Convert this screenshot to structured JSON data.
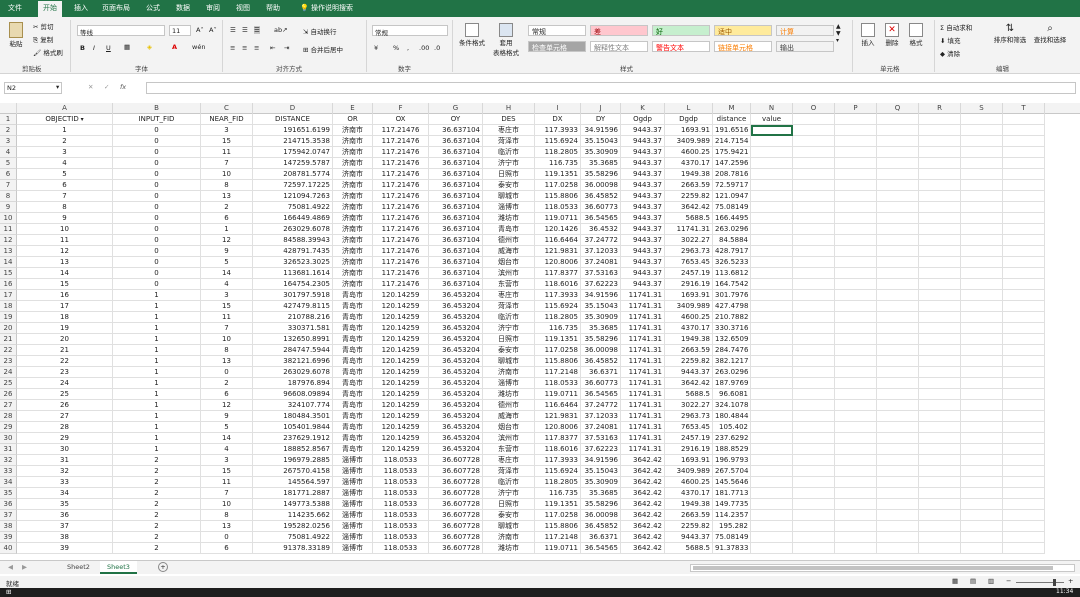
{
  "tabs": [
    "文件",
    "开始",
    "插入",
    "页面布局",
    "公式",
    "数据",
    "审阅",
    "视图",
    "帮助"
  ],
  "tell_me": "操作说明搜索",
  "ribbon": {
    "clipboard": {
      "paste": "粘贴",
      "cut": "剪切",
      "copy": "复制",
      "format_painter": "格式刷",
      "label": "剪贴板"
    },
    "font": {
      "name": "等线",
      "size": "11",
      "label": "字体"
    },
    "alignment": {
      "wrap": "自动换行",
      "merge": "合并后居中",
      "label": "对齐方式"
    },
    "number": {
      "format": "常规",
      "label": "数字"
    },
    "styles": {
      "cond_format": "条件格式",
      "table_format": "套用\n表格格式",
      "label": "样式",
      "cells": [
        {
          "text": "常规",
          "bg": "#ffffff",
          "fg": "#222222"
        },
        {
          "text": "差",
          "bg": "#ffc7ce",
          "fg": "#9c0006"
        },
        {
          "text": "好",
          "bg": "#c6efce",
          "fg": "#006100"
        },
        {
          "text": "适中",
          "bg": "#ffeb9c",
          "fg": "#9c5700"
        },
        {
          "text": "计算",
          "bg": "#f2f2f2",
          "fg": "#fa7d00"
        },
        {
          "text": "检查单元格",
          "bg": "#a5a5a5",
          "fg": "#ffffff"
        },
        {
          "text": "解释性文本",
          "bg": "#ffffff",
          "fg": "#7f7f7f"
        },
        {
          "text": "警告文本",
          "bg": "#ffffff",
          "fg": "#ff0000"
        },
        {
          "text": "链接单元格",
          "bg": "#ffffff",
          "fg": "#fa7d00"
        },
        {
          "text": "输出",
          "bg": "#f2f2f2",
          "fg": "#3f3f3f"
        }
      ]
    },
    "cells": {
      "insert": "插入",
      "delete": "删除",
      "format": "格式",
      "label": "单元格"
    },
    "editing": {
      "autosum": "自动求和",
      "fill": "填充",
      "clear": "清除",
      "sort": "排序和筛选",
      "find": "查找和选择",
      "label": "编辑"
    }
  },
  "formula_bar": {
    "name_box": "N2",
    "fx": "fx",
    "content": ""
  },
  "columns": [
    "A",
    "B",
    "C",
    "D",
    "E",
    "F",
    "G",
    "H",
    "I",
    "J",
    "K",
    "L",
    "M",
    "N",
    "O",
    "P",
    "Q",
    "R",
    "S",
    "T"
  ],
  "header_row": [
    "OBJECTID",
    "INPUT_FID",
    "NEAR_FID",
    "DISTANCE",
    "OR",
    "OX",
    "OY",
    "DES",
    "DX",
    "DY",
    "Ogdp",
    "Dgdp",
    "distance",
    "value"
  ],
  "data_rows": [
    [
      "1",
      "0",
      "3",
      "191651.6199",
      "济南市",
      "117.21476",
      "36.637104",
      "枣庄市",
      "117.3933",
      "34.91596",
      "9443.37",
      "1693.91",
      "191.6516"
    ],
    [
      "2",
      "0",
      "15",
      "214715.3538",
      "济南市",
      "117.21476",
      "36.637104",
      "菏泽市",
      "115.6924",
      "35.15043",
      "9443.37",
      "3409.989",
      "214.7154"
    ],
    [
      "3",
      "0",
      "11",
      "175942.0747",
      "济南市",
      "117.21476",
      "36.637104",
      "临沂市",
      "118.2805",
      "35.30909",
      "9443.37",
      "4600.25",
      "175.9421"
    ],
    [
      "4",
      "0",
      "7",
      "147259.5787",
      "济南市",
      "117.21476",
      "36.637104",
      "济宁市",
      "116.735",
      "35.3685",
      "9443.37",
      "4370.17",
      "147.2596"
    ],
    [
      "5",
      "0",
      "10",
      "208781.5774",
      "济南市",
      "117.21476",
      "36.637104",
      "日照市",
      "119.1351",
      "35.58296",
      "9443.37",
      "1949.38",
      "208.7816"
    ],
    [
      "6",
      "0",
      "8",
      "72597.17225",
      "济南市",
      "117.21476",
      "36.637104",
      "泰安市",
      "117.0258",
      "36.00098",
      "9443.37",
      "2663.59",
      "72.59717"
    ],
    [
      "7",
      "0",
      "13",
      "121094.7263",
      "济南市",
      "117.21476",
      "36.637104",
      "聊城市",
      "115.8806",
      "36.45852",
      "9443.37",
      "2259.82",
      "121.0947"
    ],
    [
      "8",
      "0",
      "2",
      "75081.4922",
      "济南市",
      "117.21476",
      "36.637104",
      "淄博市",
      "118.0533",
      "36.60773",
      "9443.37",
      "3642.42",
      "75.08149"
    ],
    [
      "9",
      "0",
      "6",
      "166449.4869",
      "济南市",
      "117.21476",
      "36.637104",
      "潍坊市",
      "119.0711",
      "36.54565",
      "9443.37",
      "5688.5",
      "166.4495"
    ],
    [
      "10",
      "0",
      "1",
      "263029.6078",
      "济南市",
      "117.21476",
      "36.637104",
      "青岛市",
      "120.1426",
      "36.4532",
      "9443.37",
      "11741.31",
      "263.0296"
    ],
    [
      "11",
      "0",
      "12",
      "84588.39943",
      "济南市",
      "117.21476",
      "36.637104",
      "德州市",
      "116.6464",
      "37.24772",
      "9443.37",
      "3022.27",
      "84.5884"
    ],
    [
      "12",
      "0",
      "9",
      "428791.7435",
      "济南市",
      "117.21476",
      "36.637104",
      "威海市",
      "121.9831",
      "37.12033",
      "9443.37",
      "2963.73",
      "428.7917"
    ],
    [
      "13",
      "0",
      "5",
      "326523.3025",
      "济南市",
      "117.21476",
      "36.637104",
      "烟台市",
      "120.8006",
      "37.24081",
      "9443.37",
      "7653.45",
      "326.5233"
    ],
    [
      "14",
      "0",
      "14",
      "113681.1614",
      "济南市",
      "117.21476",
      "36.637104",
      "滨州市",
      "117.8377",
      "37.53163",
      "9443.37",
      "2457.19",
      "113.6812"
    ],
    [
      "15",
      "0",
      "4",
      "164754.2305",
      "济南市",
      "117.21476",
      "36.637104",
      "东营市",
      "118.6016",
      "37.62223",
      "9443.37",
      "2916.19",
      "164.7542"
    ],
    [
      "16",
      "1",
      "3",
      "301797.5918",
      "青岛市",
      "120.14259",
      "36.453204",
      "枣庄市",
      "117.3933",
      "34.91596",
      "11741.31",
      "1693.91",
      "301.7976"
    ],
    [
      "17",
      "1",
      "15",
      "427479.8115",
      "青岛市",
      "120.14259",
      "36.453204",
      "菏泽市",
      "115.6924",
      "35.15043",
      "11741.31",
      "3409.989",
      "427.4798"
    ],
    [
      "18",
      "1",
      "11",
      "210788.216",
      "青岛市",
      "120.14259",
      "36.453204",
      "临沂市",
      "118.2805",
      "35.30909",
      "11741.31",
      "4600.25",
      "210.7882"
    ],
    [
      "19",
      "1",
      "7",
      "330371.581",
      "青岛市",
      "120.14259",
      "36.453204",
      "济宁市",
      "116.735",
      "35.3685",
      "11741.31",
      "4370.17",
      "330.3716"
    ],
    [
      "20",
      "1",
      "10",
      "132650.8991",
      "青岛市",
      "120.14259",
      "36.453204",
      "日照市",
      "119.1351",
      "35.58296",
      "11741.31",
      "1949.38",
      "132.6509"
    ],
    [
      "21",
      "1",
      "8",
      "284747.5944",
      "青岛市",
      "120.14259",
      "36.453204",
      "泰安市",
      "117.0258",
      "36.00098",
      "11741.31",
      "2663.59",
      "284.7476"
    ],
    [
      "22",
      "1",
      "13",
      "382121.6996",
      "青岛市",
      "120.14259",
      "36.453204",
      "聊城市",
      "115.8806",
      "36.45852",
      "11741.31",
      "2259.82",
      "382.1217"
    ],
    [
      "23",
      "1",
      "0",
      "263029.6078",
      "青岛市",
      "120.14259",
      "36.453204",
      "济南市",
      "117.2148",
      "36.6371",
      "11741.31",
      "9443.37",
      "263.0296"
    ],
    [
      "24",
      "1",
      "2",
      "187976.894",
      "青岛市",
      "120.14259",
      "36.453204",
      "淄博市",
      "118.0533",
      "36.60773",
      "11741.31",
      "3642.42",
      "187.9769"
    ],
    [
      "25",
      "1",
      "6",
      "96608.09894",
      "青岛市",
      "120.14259",
      "36.453204",
      "潍坊市",
      "119.0711",
      "36.54565",
      "11741.31",
      "5688.5",
      "96.6081"
    ],
    [
      "26",
      "1",
      "12",
      "324107.774",
      "青岛市",
      "120.14259",
      "36.453204",
      "德州市",
      "116.6464",
      "37.24772",
      "11741.31",
      "3022.27",
      "324.1078"
    ],
    [
      "27",
      "1",
      "9",
      "180484.3501",
      "青岛市",
      "120.14259",
      "36.453204",
      "威海市",
      "121.9831",
      "37.12033",
      "11741.31",
      "2963.73",
      "180.4844"
    ],
    [
      "28",
      "1",
      "5",
      "105401.9844",
      "青岛市",
      "120.14259",
      "36.453204",
      "烟台市",
      "120.8006",
      "37.24081",
      "11741.31",
      "7653.45",
      "105.402"
    ],
    [
      "29",
      "1",
      "14",
      "237629.1912",
      "青岛市",
      "120.14259",
      "36.453204",
      "滨州市",
      "117.8377",
      "37.53163",
      "11741.31",
      "2457.19",
      "237.6292"
    ],
    [
      "30",
      "1",
      "4",
      "188852.8567",
      "青岛市",
      "120.14259",
      "36.453204",
      "东营市",
      "118.6016",
      "37.62223",
      "11741.31",
      "2916.19",
      "188.8529"
    ],
    [
      "31",
      "2",
      "3",
      "196979.2885",
      "淄博市",
      "118.0533",
      "36.607728",
      "枣庄市",
      "117.3933",
      "34.91596",
      "3642.42",
      "1693.91",
      "196.9793"
    ],
    [
      "32",
      "2",
      "15",
      "267570.4158",
      "淄博市",
      "118.0533",
      "36.607728",
      "菏泽市",
      "115.6924",
      "35.15043",
      "3642.42",
      "3409.989",
      "267.5704"
    ],
    [
      "33",
      "2",
      "11",
      "145564.597",
      "淄博市",
      "118.0533",
      "36.607728",
      "临沂市",
      "118.2805",
      "35.30909",
      "3642.42",
      "4600.25",
      "145.5646"
    ],
    [
      "34",
      "2",
      "7",
      "181771.2887",
      "淄博市",
      "118.0533",
      "36.607728",
      "济宁市",
      "116.735",
      "35.3685",
      "3642.42",
      "4370.17",
      "181.7713"
    ],
    [
      "35",
      "2",
      "10",
      "149773.5388",
      "淄博市",
      "118.0533",
      "36.607728",
      "日照市",
      "119.1351",
      "35.58296",
      "3642.42",
      "1949.38",
      "149.7735"
    ],
    [
      "36",
      "2",
      "8",
      "114235.662",
      "淄博市",
      "118.0533",
      "36.607728",
      "泰安市",
      "117.0258",
      "36.00098",
      "3642.42",
      "2663.59",
      "114.2357"
    ],
    [
      "37",
      "2",
      "13",
      "195282.0256",
      "淄博市",
      "118.0533",
      "36.607728",
      "聊城市",
      "115.8806",
      "36.45852",
      "3642.42",
      "2259.82",
      "195.282"
    ],
    [
      "38",
      "2",
      "0",
      "75081.4922",
      "淄博市",
      "118.0533",
      "36.607728",
      "济南市",
      "117.2148",
      "36.6371",
      "3642.42",
      "9443.37",
      "75.08149"
    ],
    [
      "39",
      "2",
      "6",
      "91378.33189",
      "淄博市",
      "118.0533",
      "36.607728",
      "潍坊市",
      "119.0711",
      "36.54565",
      "3642.42",
      "5688.5",
      "91.37833"
    ]
  ],
  "sheets": [
    "Sheet2",
    "Sheet3"
  ],
  "active_sheet": "Sheet3",
  "status": {
    "ready": "就绪",
    "time": "11:34"
  },
  "accent": "#217346"
}
